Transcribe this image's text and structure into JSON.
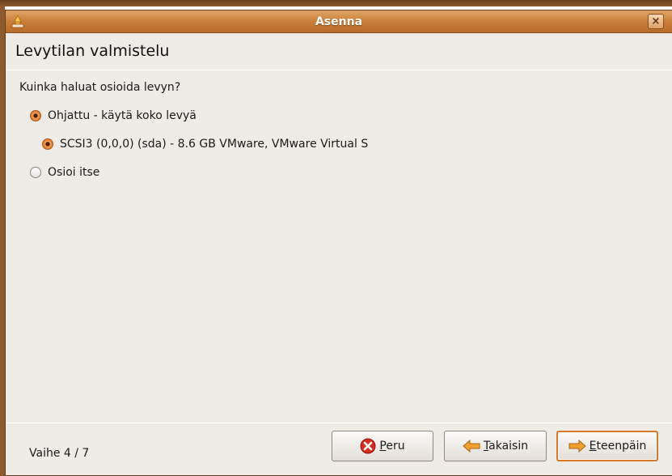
{
  "window": {
    "title": "Asenna",
    "close_label": "×"
  },
  "page": {
    "heading": "Levytilan valmistelu",
    "question": "Kuinka haluat osioida levyn?"
  },
  "options": [
    {
      "label": "Ohjattu - käytä koko levyä",
      "checked": true
    },
    {
      "label": "SCSI3 (0,0,0) (sda) - 8.6 GB VMware, VMware Virtual S",
      "checked": true,
      "indent": true
    },
    {
      "label": "Osioi itse",
      "checked": false
    }
  ],
  "footer": {
    "step": "Vaihe 4 / 7",
    "cancel": {
      "mnemonic": "P",
      "rest": "eru"
    },
    "back": {
      "mnemonic": "T",
      "rest": "akaisin"
    },
    "forward": {
      "mnemonic": "E",
      "rest": "teenpäin"
    }
  },
  "colors": {
    "titlebar": "#c97f3a",
    "accent": "#e07a2a",
    "cancel_icon": "#d62b1f",
    "arrow_icon": "#f0a030"
  }
}
